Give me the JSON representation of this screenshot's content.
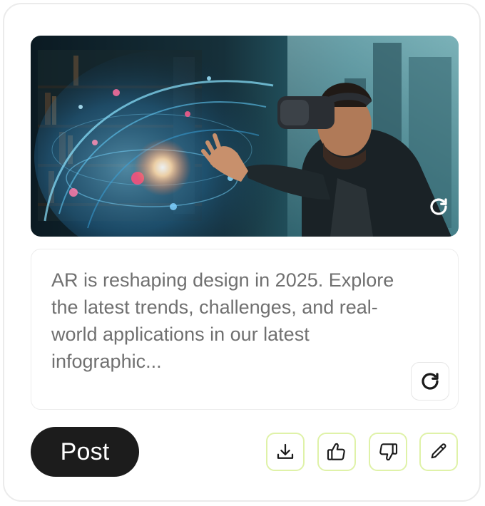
{
  "hero": {
    "image_description_icon": "hero-image",
    "refresh_icon": "refresh-icon"
  },
  "caption": {
    "text": "AR is reshaping design in 2025. Explore\nthe latest trends, challenges, and real-\nworld applications in our latest\ninfographic..."
  },
  "actions": {
    "post_label": "Post",
    "buttons": [
      {
        "name": "download",
        "icon": "download-icon"
      },
      {
        "name": "like",
        "icon": "thumbs-up-icon"
      },
      {
        "name": "dislike",
        "icon": "thumbs-down-icon"
      },
      {
        "name": "edit",
        "icon": "pencil-icon"
      }
    ]
  },
  "colors": {
    "card_border": "#ebebeb",
    "caption_text": "#707070",
    "post_bg": "#1c1c1c",
    "post_text": "#ffffff",
    "action_border": "#dff2a8"
  }
}
